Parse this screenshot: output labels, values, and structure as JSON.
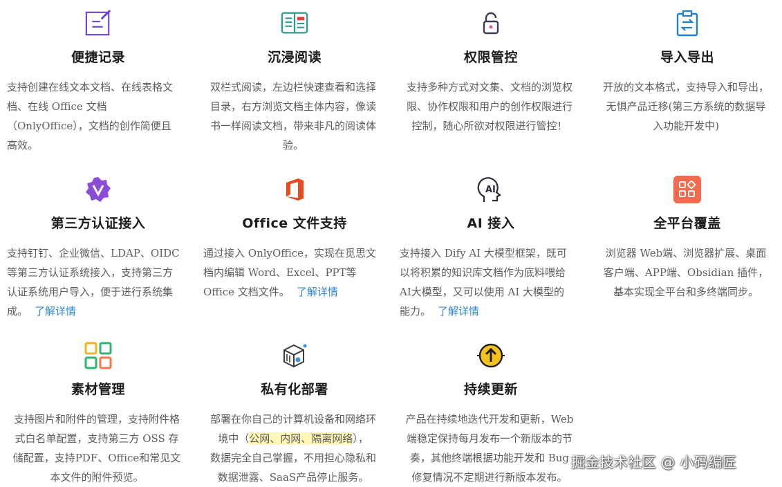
{
  "features": [
    {
      "title": "便捷记录",
      "icon": "pencil-note-icon",
      "desc": [
        "支持创建在线文本文档、在线表格文",
        "档、在线 Office 文档",
        "（OnlyOffice），文档的创作简便且",
        "高效。"
      ],
      "link": ""
    },
    {
      "title": "沉浸阅读",
      "icon": "open-book-icon",
      "desc": [
        "双栏式阅读，左边栏快速查看和选择",
        "目录，右方浏览文档主体内容，像读",
        "书一样阅读文档，带来非凡的阅读体",
        "验。"
      ],
      "link": ""
    },
    {
      "title": "权限管控",
      "icon": "lock-icon",
      "desc": [
        "支持多种方式对文集、文档的浏览权",
        "限、协作权限和用户的创作权限进行",
        "控制，随心所欲对权限进行管控！"
      ],
      "link": ""
    },
    {
      "title": "导入导出",
      "icon": "import-export-icon",
      "desc": [
        "开放的文本格式，支持导入和导出，",
        "无惧产品迁移(第三方系统的数据导",
        "入功能开发中)"
      ],
      "link": ""
    },
    {
      "title": "第三方认证接入",
      "icon": "verified-badge-icon",
      "desc": [
        "支持钉钉、企业微信、LDAP、OIDC",
        "等第三方认证系统接入，支持第三方",
        "认证系统用户导入，便于进行系统集",
        "成。"
      ],
      "link": "了解详情"
    },
    {
      "title": "Office 文件支持",
      "icon": "office-icon",
      "desc": [
        "通过接入 OnlyOffice，实现在觅思文",
        "档内编辑 Word、Excel、PPT等",
        "Office 文档文件。"
      ],
      "link": "了解详情"
    },
    {
      "title": "AI 接入",
      "icon": "ai-head-icon",
      "desc": [
        "支持接入 Dify AI 大模型框架，既可",
        "以将积累的知识库文档作为底料喂给",
        "AI大模型，又可以使用 AI 大模型的",
        "能力。"
      ],
      "link": "了解详情"
    },
    {
      "title": "全平台覆盖",
      "icon": "multi-platform-icon",
      "desc": [
        "浏览器 Web端、浏览器扩展、桌面",
        "客户端、APP端、Obsidian 插件，",
        "基本实现全平台和多终端同步。"
      ],
      "link": ""
    },
    {
      "title": "素材管理",
      "icon": "grid-squares-icon",
      "desc": [
        "支持图片和附件的管理，支持附件格",
        "式白名单配置，支持第三方 OSS 存",
        "储配置，支持PDF、Office和常见文",
        "本文件的附件预览。"
      ],
      "link": ""
    },
    {
      "title": "私有化部署",
      "icon": "private-box-icon",
      "desc": [
        "部署在你自己的计算机设备和网络环",
        "境中（公网、内网、隔离网络），",
        "数据完全自己掌握，不用担心隐私和",
        "数据泄露、SaaS产品停止服务。"
      ],
      "link": ""
    },
    {
      "title": "持续更新",
      "icon": "update-arrow-icon",
      "desc": [
        "产品在持续地迭代开发和更新，Web",
        "端稳定保持每月发布一个新版本的节",
        "奏，其他终端根据功能开发和 Bug",
        "修复情况不定期进行新版本发布。"
      ],
      "link": ""
    }
  ],
  "watermark": "掘金技术社区 @ 小码编匠",
  "colors": {
    "accent": "#2f86d6",
    "title": "#1c1c1c",
    "desc": "#5d5d5d"
  }
}
